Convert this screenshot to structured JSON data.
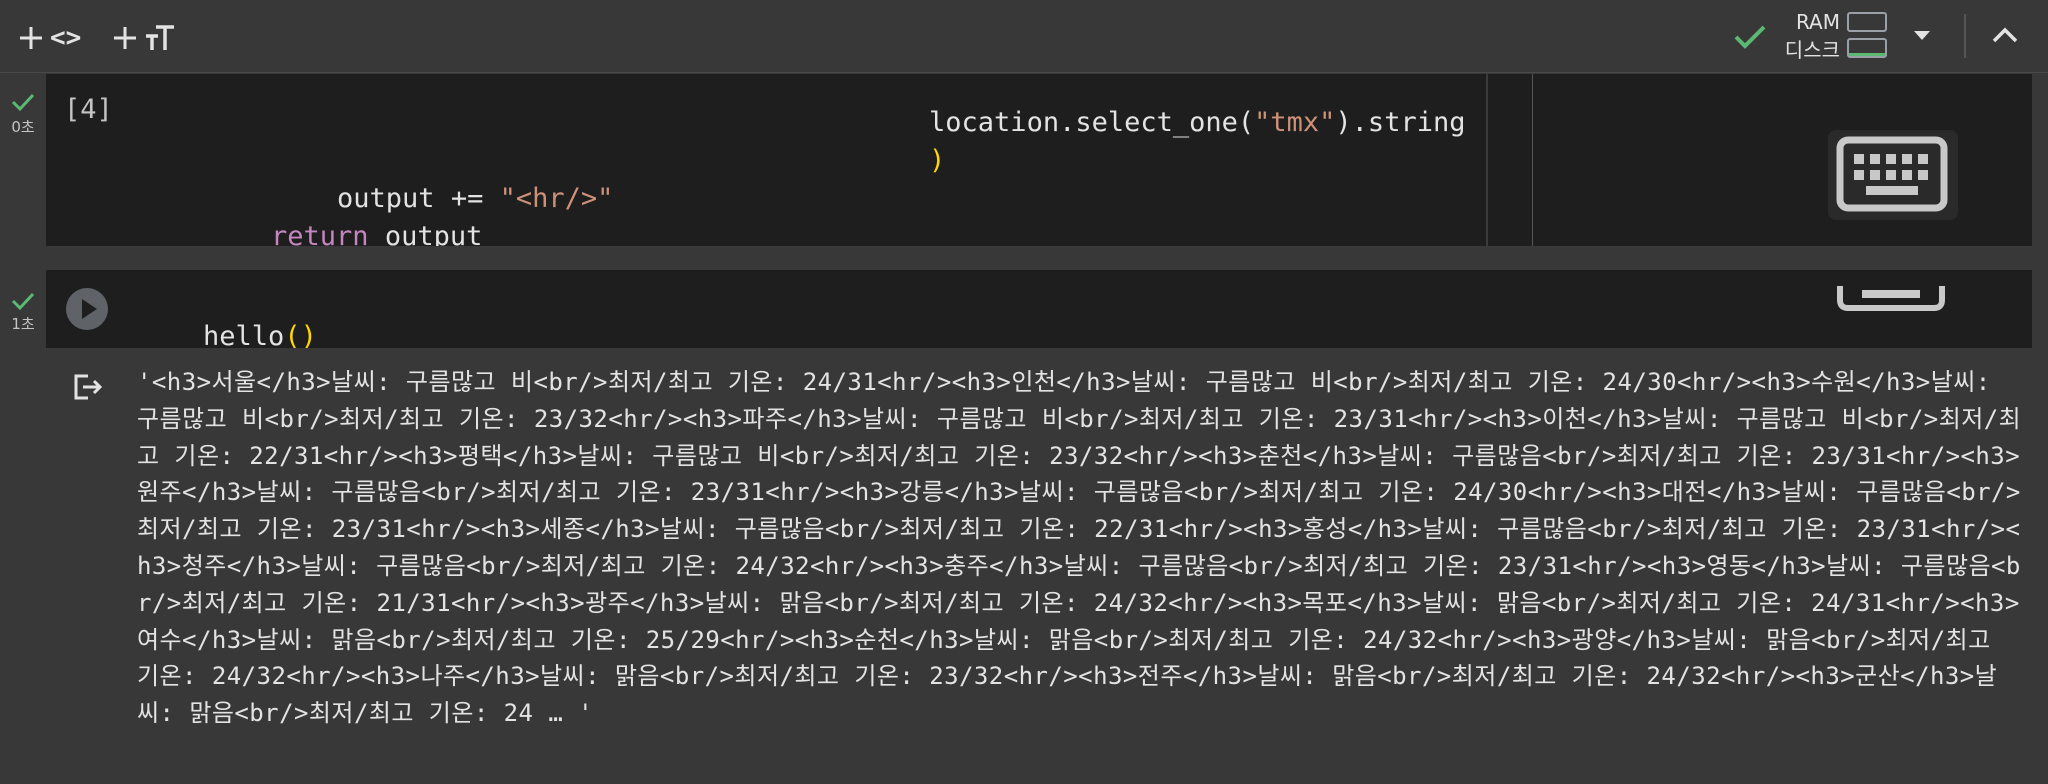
{
  "toolbar": {
    "add_code_label": "<>",
    "resources": {
      "ram_label": "RAM",
      "disk_label": "디스크"
    }
  },
  "cell1": {
    "time": "0초",
    "exec_count": "[4]",
    "line_a_parts": [
      "location.select_one(",
      "\"tmx\"",
      ").string"
    ],
    "line_b": ")",
    "line_c_parts": [
      "output += ",
      "\"<hr/>\""
    ],
    "line_d_parts": [
      "return",
      " output"
    ]
  },
  "cell2": {
    "time": "1초",
    "code_parts": [
      "hello",
      "()"
    ]
  },
  "output": {
    "text": "'<h3>서울</h3>날씨: 구름많고 비<br/>최저/최고 기온: 24/31<hr/><h3>인천</h3>날씨: 구름많고 비<br/>최저/최고 기온: 24/30<hr/><h3>수원</h3>날씨: 구름많고 비<br/>최저/최고 기온: 23/32<hr/><h3>파주</h3>날씨: 구름많고 비<br/>최저/최고 기온: 23/31<hr/><h3>이천</h3>날씨: 구름많고 비<br/>최저/최고 기온: 22/31<hr/><h3>평택</h3>날씨: 구름많고 비<br/>최저/최고 기온: 23/32<hr/><h3>춘천</h3>날씨: 구름많음<br/>최저/최고 기온: 23/31<hr/><h3>원주</h3>날씨: 구름많음<br/>최저/최고 기온: 23/31<hr/><h3>강릉</h3>날씨: 구름많음<br/>최저/최고 기온: 24/30<hr/><h3>대전</h3>날씨: 구름많음<br/>최저/최고 기온: 23/31<hr/><h3>세종</h3>날씨: 구름많음<br/>최저/최고 기온: 22/31<hr/><h3>홍성</h3>날씨: 구름많음<br/>최저/최고 기온: 23/31<hr/><h3>청주</h3>날씨: 구름많음<br/>최저/최고 기온: 24/32<hr/><h3>충주</h3>날씨: 구름많음<br/>최저/최고 기온: 23/31<hr/><h3>영동</h3>날씨: 구름많음<br/>최저/최고 기온: 21/31<hr/><h3>광주</h3>날씨: 맑음<br/>최저/최고 기온: 24/32<hr/><h3>목포</h3>날씨: 맑음<br/>최저/최고 기온: 24/31<hr/><h3>여수</h3>날씨: 맑음<br/>최저/최고 기온: 25/29<hr/><h3>순천</h3>날씨: 맑음<br/>최저/최고 기온: 24/32<hr/><h3>광양</h3>날씨: 맑음<br/>최저/최고 기온: 24/32<hr/><h3>나주</h3>날씨: 맑음<br/>최저/최고 기온: 23/32<hr/><h3>전주</h3>날씨: 맑음<br/>최저/최고 기온: 24/32<hr/><h3>군산</h3>날씨: 맑음<br/>최저/최고 기온: 24 … '"
  },
  "colors": {
    "background": "#383838",
    "cell": "#1e1e1e",
    "success_green": "#5bb974",
    "string": "#ce9178",
    "paren": "#ffd700",
    "keyword": "#c586c0"
  },
  "icons": [
    "add-icon",
    "code-icon",
    "add-icon",
    "text-icon",
    "check-icon",
    "dropdown-icon",
    "chevron-up-icon",
    "keyboard-icon",
    "play-icon",
    "output-icon"
  ]
}
